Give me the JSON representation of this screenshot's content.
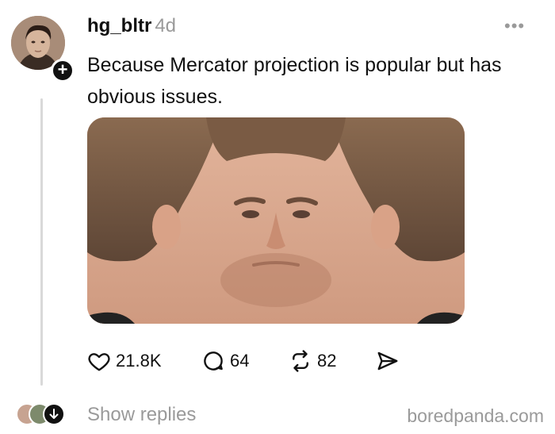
{
  "post": {
    "username": "hg_bltr",
    "time": "4d",
    "text": "Because Mercator projection is popular but has obvious issues.",
    "more_icon": "more-horizontal-icon"
  },
  "follow_badge": {
    "symbol": "+"
  },
  "actions": {
    "likes": "21.8K",
    "comments": "64",
    "reposts": "82"
  },
  "footer": {
    "show_replies": "Show replies",
    "watermark": "boredpanda.com"
  },
  "colors": {
    "text": "#111111",
    "muted": "#9a9a9a",
    "thread_line": "#d9d9d9"
  }
}
